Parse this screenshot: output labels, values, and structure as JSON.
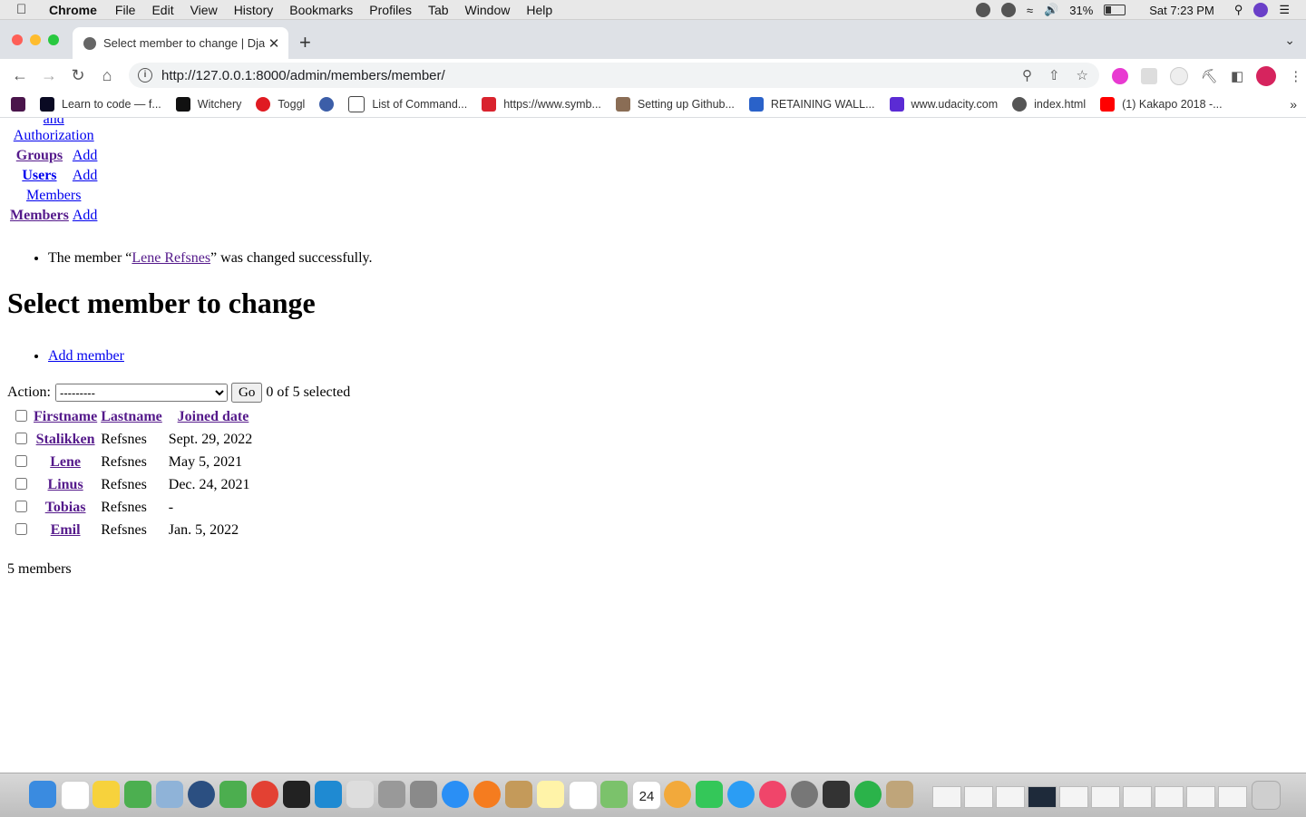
{
  "menubar": {
    "app": "Chrome",
    "items": [
      "File",
      "Edit",
      "View",
      "History",
      "Bookmarks",
      "Profiles",
      "Tab",
      "Window",
      "Help"
    ],
    "battery": "31%",
    "clock": "Sat 7:23 PM"
  },
  "tab": {
    "title": "Select member to change | Dja"
  },
  "address": {
    "url": "http://127.0.0.1:8000/admin/members/member/"
  },
  "bookmarks": [
    {
      "label": "Learn to code — f...",
      "color": "#0a0a23"
    },
    {
      "label": "Witchery",
      "color": "#111111"
    },
    {
      "label": "Toggl",
      "color": "#e01b22"
    },
    {
      "label": "",
      "color": "#3c5ea8"
    },
    {
      "label": "List of Command...",
      "color": "#444444"
    },
    {
      "label": "https://www.symb...",
      "color": "#d9232e"
    },
    {
      "label": "Setting up Github...",
      "color": "#8a6d55"
    },
    {
      "label": "RETAINING WALL...",
      "color": "#2a62c9"
    },
    {
      "label": "www.udacity.com",
      "color": "#5b2bd4"
    },
    {
      "label": "index.html",
      "color": "#555555"
    },
    {
      "label": "(1) Kakapo 2018 -...",
      "color": "#ff0000"
    }
  ],
  "nav": {
    "partial_top": "and",
    "auth_title": "Authorization",
    "groups": "Groups",
    "groups_add": "Add",
    "users": "Users",
    "users_add": "Add",
    "members_app": "Members",
    "members": "Members",
    "members_add": "Add"
  },
  "message": {
    "before": "The member “",
    "link": "Lene Refsnes",
    "after": "” was changed successfully."
  },
  "page_title": "Select member to change",
  "add_member": "Add member",
  "actions": {
    "label": "Action:",
    "selected_option": "---------",
    "go": "Go",
    "counter": "0 of 5 selected"
  },
  "table": {
    "headers": {
      "firstname": "Firstname",
      "lastname": "Lastname",
      "joined": "Joined date"
    },
    "rows": [
      {
        "firstname": "Stalikken",
        "lastname": "Refsnes",
        "joined": "Sept. 29, 2022"
      },
      {
        "firstname": "Lene",
        "lastname": "Refsnes",
        "joined": "May 5, 2021"
      },
      {
        "firstname": "Linus",
        "lastname": "Refsnes",
        "joined": "Dec. 24, 2021"
      },
      {
        "firstname": "Tobias",
        "lastname": "Refsnes",
        "joined": "-"
      },
      {
        "firstname": "Emil",
        "lastname": "Refsnes",
        "joined": "Jan. 5, 2022"
      }
    ]
  },
  "result_count": "5 members",
  "dock_calendar_day": "24"
}
